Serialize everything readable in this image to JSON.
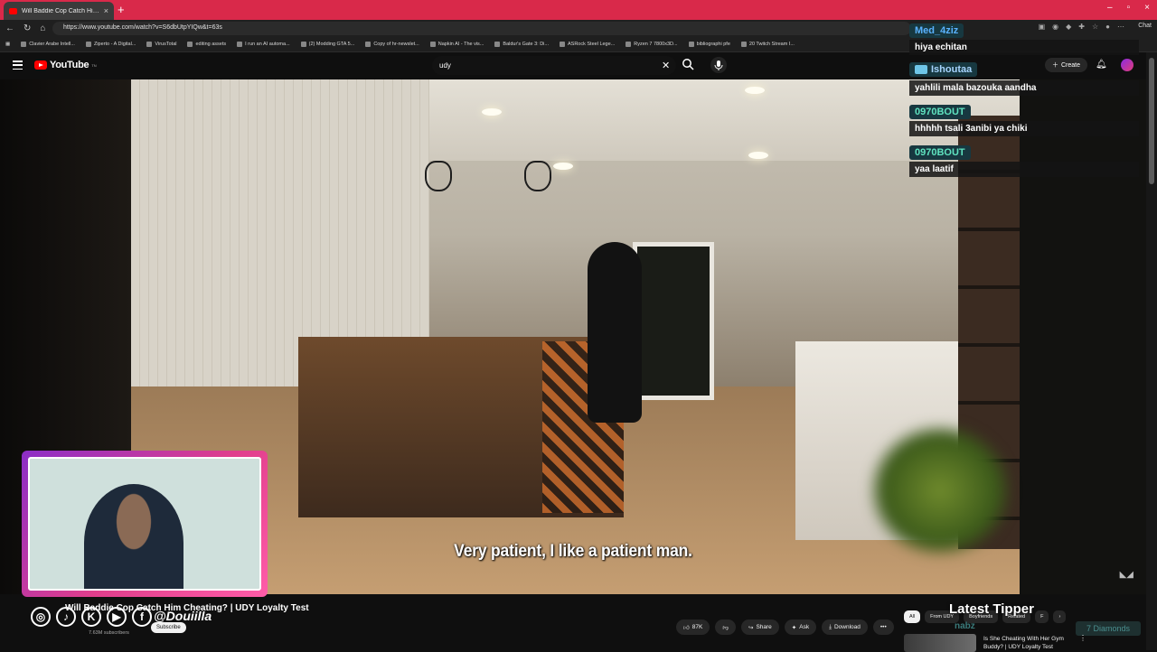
{
  "browser": {
    "tab_title": "Will Baddie Cop Catch Him Ch",
    "tab_close": "×",
    "new_tab": "+",
    "url": "https://www.youtube.com/watch?v=S6dbUtpYIQw&t=63s",
    "chat_button": "Chat",
    "window_controls": [
      "–",
      "▫",
      "×"
    ]
  },
  "bookmarks": [
    "Clavier Arabe Intell...",
    "Ziperto - A Digital...",
    "VirusTotal",
    "editing assets",
    "I run an AI automa...",
    "(2) Modding GTA 5...",
    "Copy of hr-newslet...",
    "Napkin AI - The vis...",
    "Baldur's Gate 3: Di...",
    "ASRock Steel Lege...",
    "Ryzen 7 7800x3D...",
    "bibliographi pfe",
    "20 Twitch Stream I..."
  ],
  "youtube": {
    "logo": "YouTube",
    "logo_country": "TN",
    "search_value": "udy",
    "create_label": "Create"
  },
  "video": {
    "subtitle": "Very patient, I like a patient man."
  },
  "chat": [
    {
      "user": "Med_4ziz",
      "message": "hiya echitan"
    },
    {
      "user": "Ishoutaa",
      "message": "yahlili mala bazouka aandha"
    },
    {
      "user": "0970BOUT",
      "message": "hhhhh tsali 3anibi ya chiki"
    },
    {
      "user": "0970BOUT",
      "message": "yaa laatif"
    }
  ],
  "info": {
    "title": "Will Baddie Cop Catch Him Cheating? | UDY Loyalty Test",
    "handle": "@Douiilla",
    "subscribe": "Subscribe",
    "subscribers": "7.63M subscribers",
    "likes": "87K",
    "share": "Share",
    "ask": "Ask",
    "download": "Download",
    "more": "•••"
  },
  "chips": [
    "All",
    "From UDY",
    "Boyfriends",
    "Related",
    "F"
  ],
  "tipper": {
    "heading": "Latest Tipper",
    "name": "nabz",
    "amount": "7 Diamonds"
  },
  "recommendation": {
    "title": "Is She Cheating With Her Gym Buddy? | UDY Loyalty Test"
  }
}
